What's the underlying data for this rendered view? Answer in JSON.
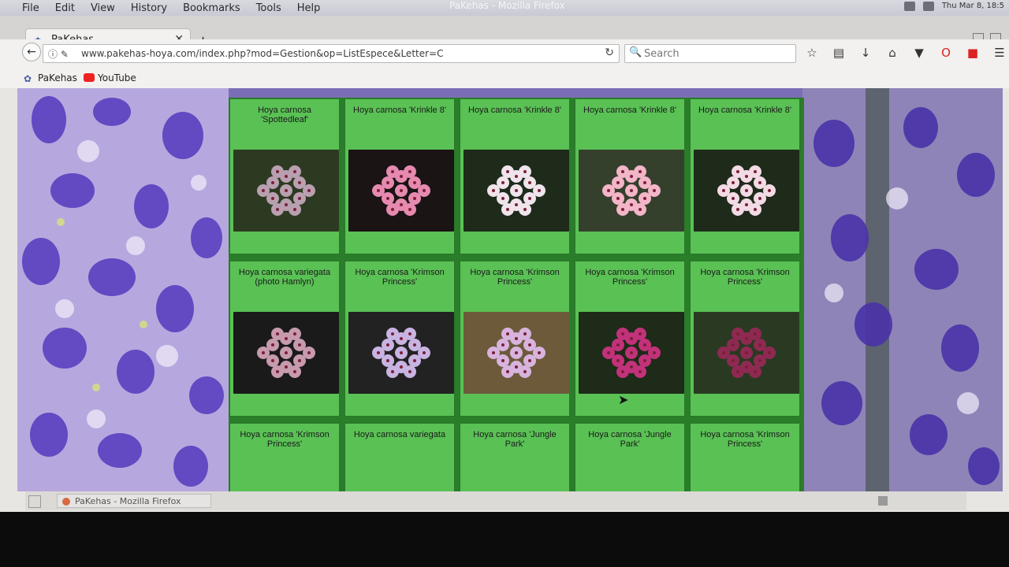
{
  "window": {
    "title": "PaKehas - Mozilla Firefox",
    "clock": "Thu Mar 8, 18:5"
  },
  "menu": [
    "File",
    "Edit",
    "View",
    "History",
    "Bookmarks",
    "Tools",
    "Help"
  ],
  "tab": {
    "title": "PaKehas"
  },
  "urlbar": {
    "url": "www.pakehas-hoya.com/index.php?mod=Gestion&op=ListEspece&Letter=C"
  },
  "search": {
    "placeholder": "Search"
  },
  "bookmarks": [
    {
      "label": "PaKehas"
    },
    {
      "label": "YouTube"
    }
  ],
  "status": {
    "task_label": "PaKehas - Mozilla Firefox"
  },
  "colors": {
    "cell_green": "#5ac155",
    "grid_border": "#2a7a2a"
  },
  "grid": {
    "rows": [
      [
        "Hoya carnosa 'Spottedleaf'",
        "Hoya carnosa 'Krinkle 8'",
        "Hoya carnosa 'Krinkle 8'",
        "Hoya carnosa 'Krinkle 8'",
        "Hoya carnosa 'Krinkle 8'"
      ],
      [
        "Hoya carnosa variegata (photo Hamlyn)",
        "Hoya carnosa 'Krimson Princess'",
        "Hoya carnosa 'Krimson Princess'",
        "Hoya carnosa 'Krimson Princess'",
        "Hoya carnosa 'Krimson Princess'"
      ],
      [
        "Hoya carnosa 'Krimson Princess'",
        "Hoya carnosa variegata",
        "Hoya carnosa 'Jungle Park'",
        "Hoya carnosa 'Jungle Park'",
        "Hoya carnosa 'Krimson Princess'"
      ]
    ]
  }
}
